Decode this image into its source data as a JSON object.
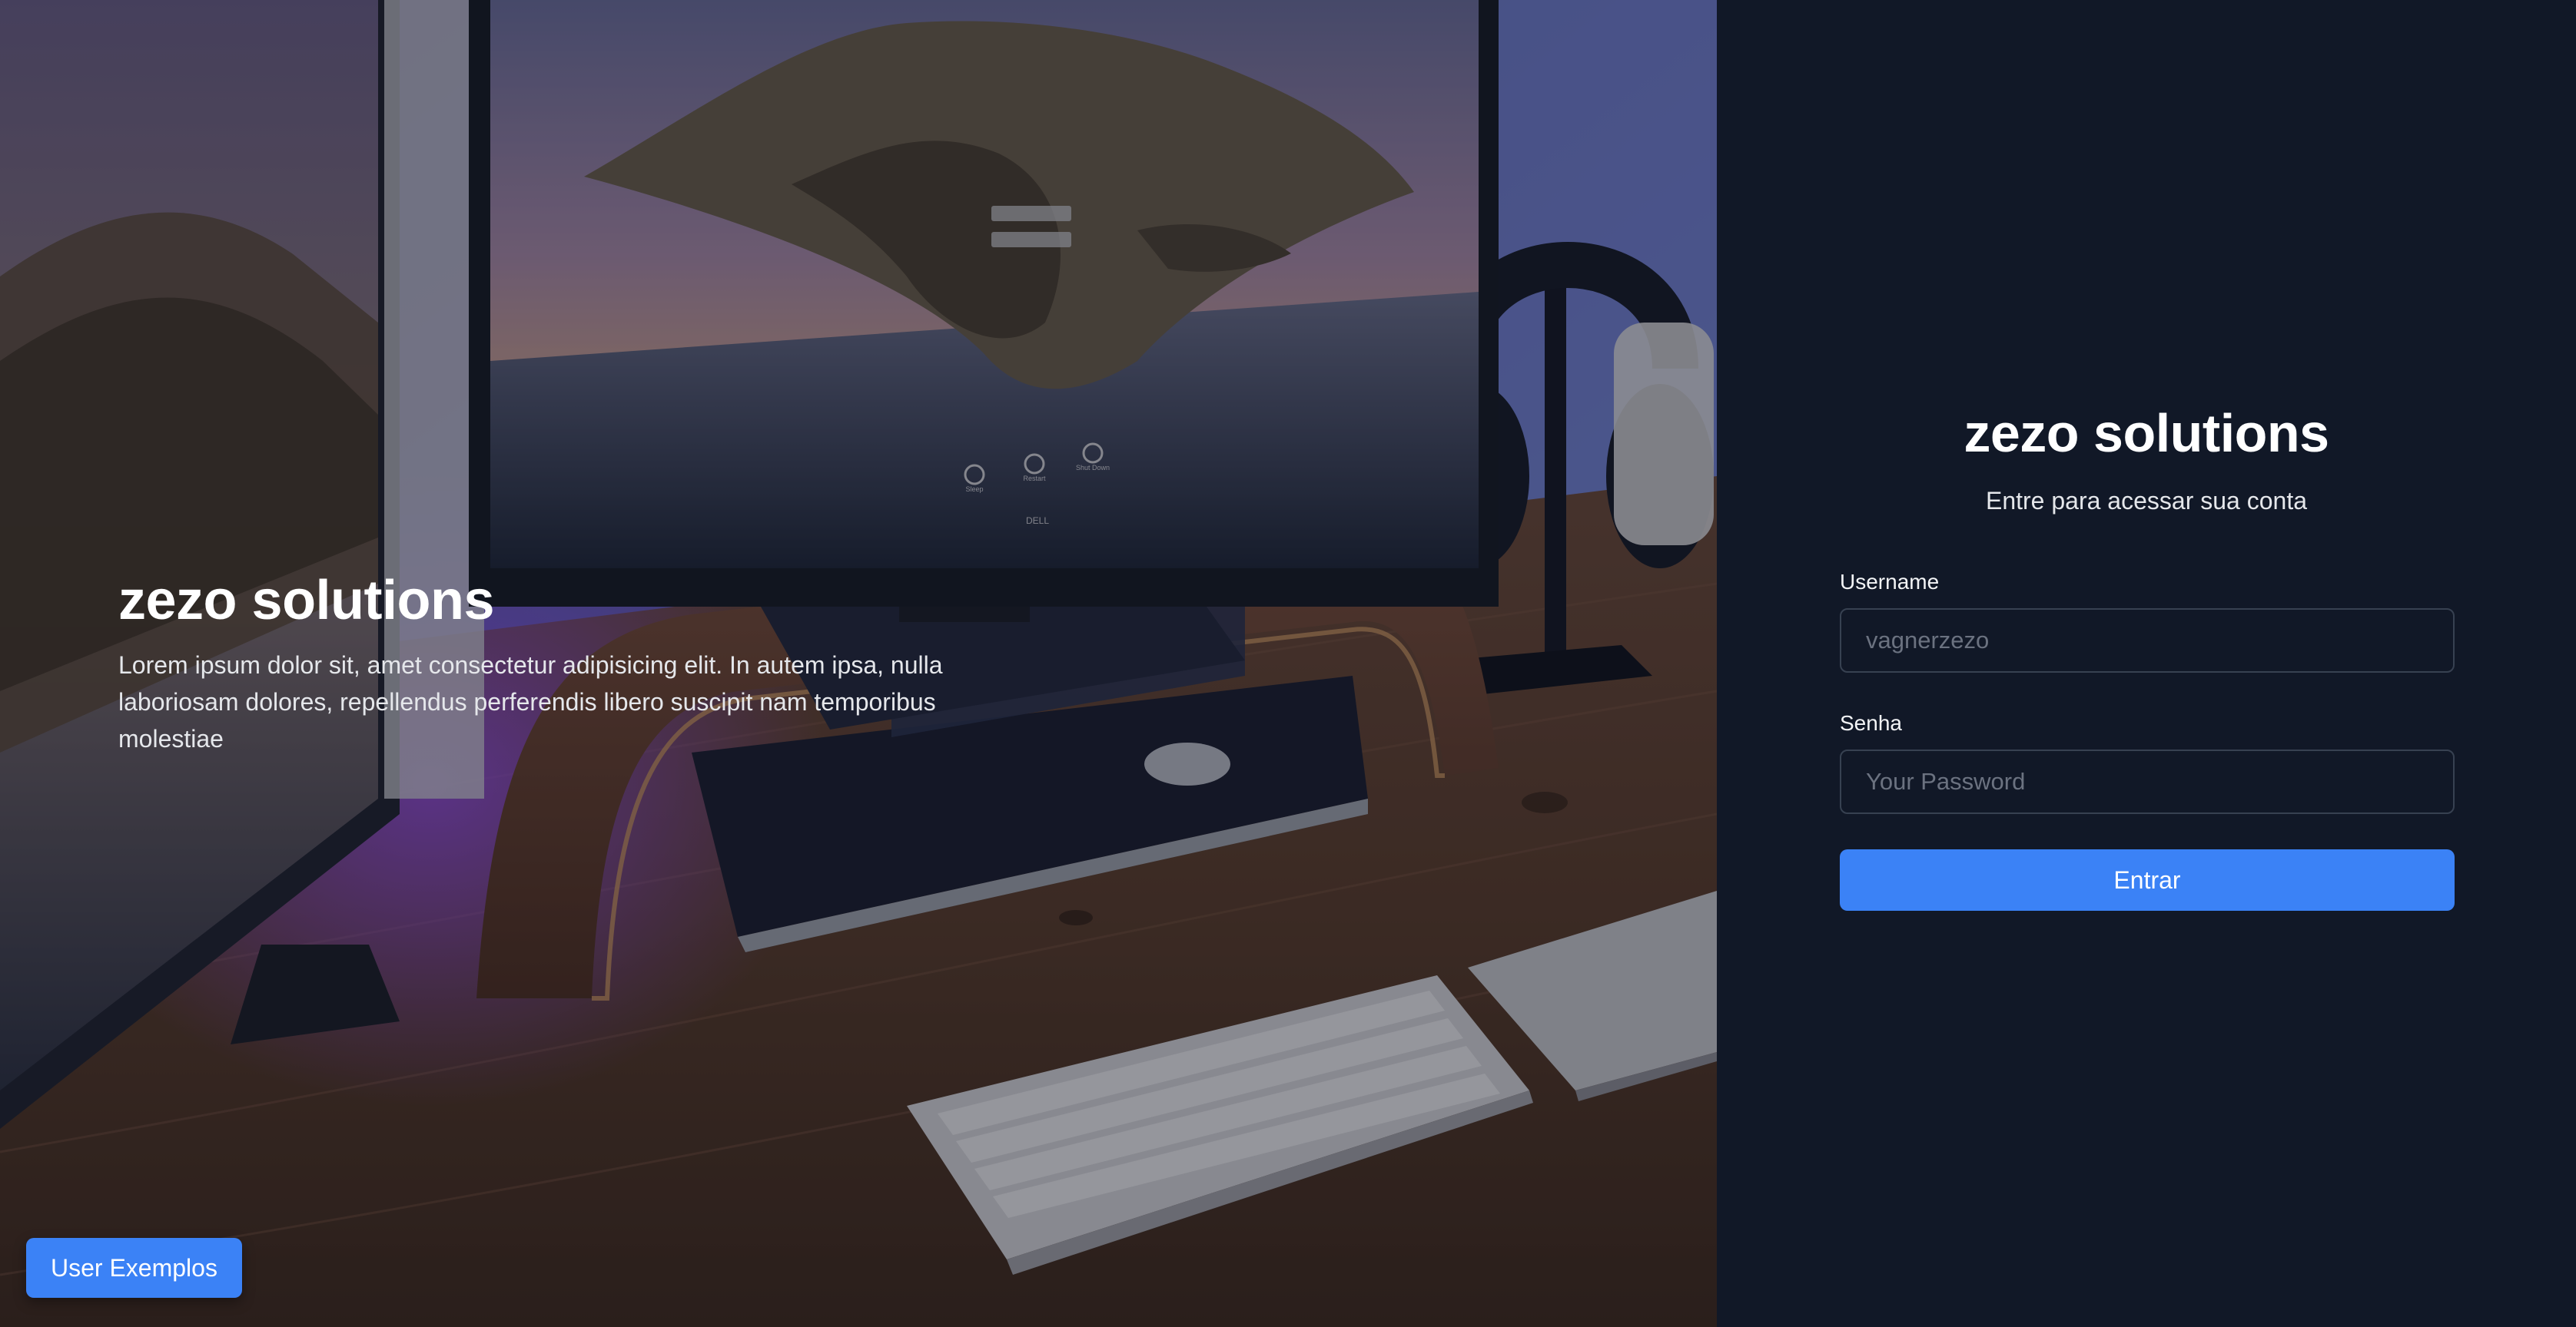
{
  "hero": {
    "title": "zezo solutions",
    "description": "Lorem ipsum dolor sit, amet consectetur adipisicing elit. In autem ipsa, nulla laboriosam dolores, repellendus perferendis libero suscipit nam temporibus molestiae",
    "examples_button_label": "User Exemplos",
    "photo_text": {
      "monitor_brand": "DELL",
      "power_sleep": "Sleep",
      "power_restart": "Restart",
      "power_shutdown": "Shut Down"
    }
  },
  "login": {
    "title": "zezo solutions",
    "subtitle": "Entre para acessar sua conta",
    "username": {
      "label": "Username",
      "placeholder": "vagnerzezo",
      "value": ""
    },
    "password": {
      "label": "Senha",
      "placeholder": "Your Password",
      "value": ""
    },
    "submit_label": "Entrar"
  },
  "colors": {
    "panel_background": "#111827",
    "accent": "#3b82f6",
    "input_border": "#374151",
    "placeholder": "#6b7280"
  }
}
